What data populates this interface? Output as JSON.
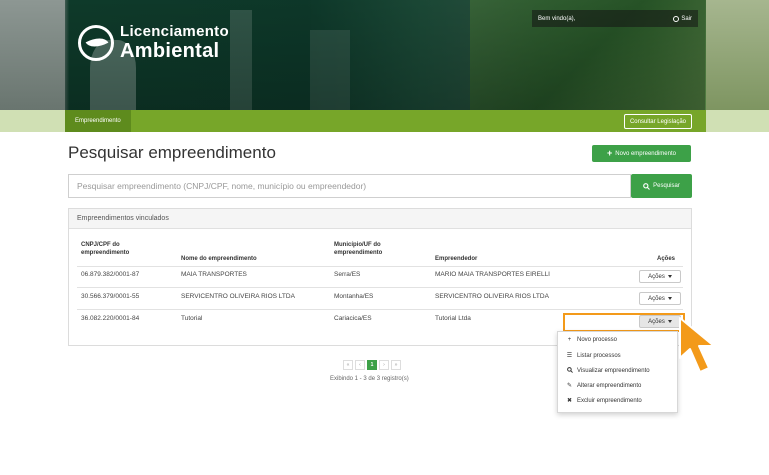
{
  "header": {
    "brand_line1": "Licenciamento",
    "brand_line2": "Ambiental",
    "welcome": "Bem vindo(a),",
    "logout": "Sair"
  },
  "nav": {
    "item": "Empreendimento",
    "legislation_button": "Consultar Legislação"
  },
  "page": {
    "title": "Pesquisar empreendimento",
    "new_button": "Novo empreendimento",
    "search_placeholder": "Pesquisar empreendimento (CNPJ/CPF, nome, município ou empreendedor)",
    "search_button": "Pesquisar"
  },
  "panel": {
    "title": "Empreendimentos vinculados",
    "columns": {
      "cnpj": "CNPJ/CPF do empreendimento",
      "nome": "Nome do empreendimento",
      "municipio": "Município/UF do empreendimento",
      "empreendedor": "Empreendedor",
      "acoes": "Ações"
    },
    "rows": [
      {
        "cnpj": "06.879.382/0001-87",
        "nome": "MAIA TRANSPORTES",
        "municipio": "Serra/ES",
        "empreendedor": "MARIO MAIA TRANSPORTES EIRELLI",
        "acoes": "Ações"
      },
      {
        "cnpj": "30.566.379/0001-55",
        "nome": "SERVICENTRO OLIVEIRA RIOS LTDA",
        "municipio": "Montanha/ES",
        "empreendedor": "SERVICENTRO OLIVEIRA RIOS LTDA",
        "acoes": "Ações"
      },
      {
        "cnpj": "36.082.220/0001-84",
        "nome": "Tutorial",
        "municipio": "Cariacica/ES",
        "empreendedor": "Tutorial Ltda",
        "acoes": "Ações"
      }
    ]
  },
  "dropdown": {
    "items": [
      {
        "label": "Novo processo",
        "icon": "plus-icon"
      },
      {
        "label": "Listar processos",
        "icon": "list-icon"
      },
      {
        "label": "Visualizar empreendimento",
        "icon": "search-icon"
      },
      {
        "label": "Alterar empreendimento",
        "icon": "pencil-icon"
      },
      {
        "label": "Excluir empreendimento",
        "icon": "close-icon"
      }
    ]
  },
  "pagination": {
    "first": "«",
    "prev": "‹",
    "current": "1",
    "next": "›",
    "last": "»",
    "info": "Exibindo 1 - 3 de 3 registro(s)"
  },
  "colors": {
    "nav_green": "#77a629",
    "button_green": "#3da148",
    "highlight_orange": "#f39a1a"
  }
}
